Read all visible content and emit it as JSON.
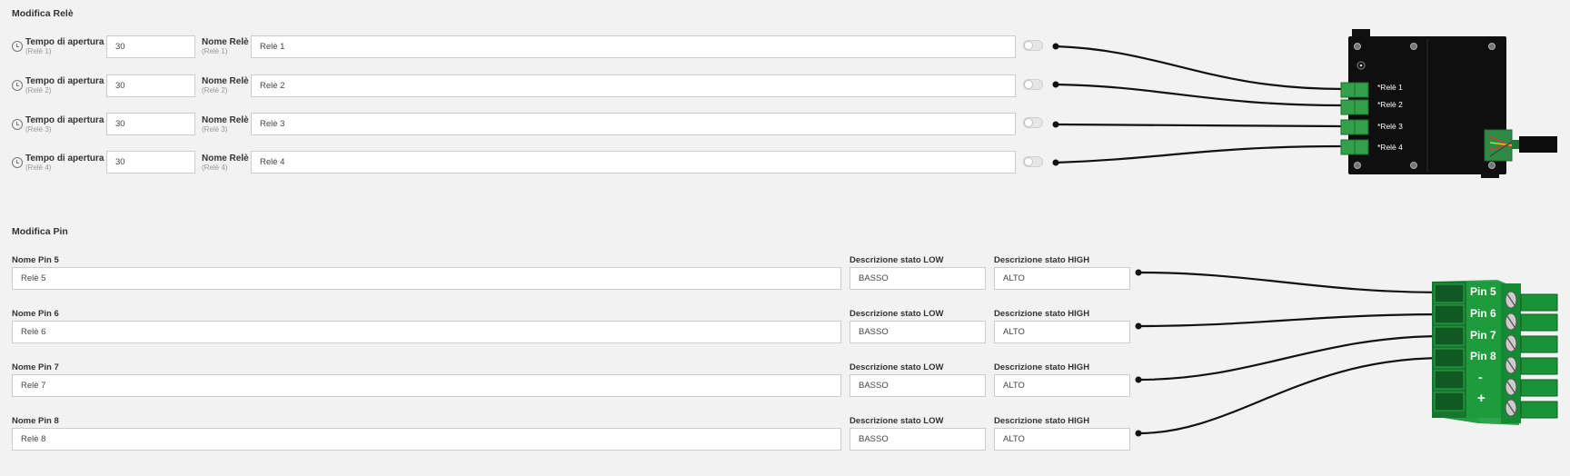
{
  "relay_section": {
    "title": "Modifica Relè",
    "rows": [
      {
        "time_label": "Tempo di apertura",
        "time_sub": "(Relè 1)",
        "time_value": "30",
        "name_label": "Nome Relè",
        "name_sub": "(Relè 1)",
        "name_value": "Relè 1",
        "toggle_on": false,
        "board_label": "*Relè 1"
      },
      {
        "time_label": "Tempo di apertura",
        "time_sub": "(Relè 2)",
        "time_value": "30",
        "name_label": "Nome Relè",
        "name_sub": "(Relè 2)",
        "name_value": "Relè 2",
        "toggle_on": false,
        "board_label": "*Relè 2"
      },
      {
        "time_label": "Tempo di apertura",
        "time_sub": "(Relè 3)",
        "time_value": "30",
        "name_label": "Nome Relè",
        "name_sub": "(Relè 3)",
        "name_value": "Relè 3",
        "toggle_on": false,
        "board_label": "*Relè 3"
      },
      {
        "time_label": "Tempo di apertura",
        "time_sub": "(Relè 4)",
        "time_value": "30",
        "name_label": "Nome Relè",
        "name_sub": "(Relè 4)",
        "name_value": "Relè 4",
        "toggle_on": false,
        "board_label": "*Relè 4"
      }
    ]
  },
  "pin_section": {
    "title": "Modifica Pin",
    "rows": [
      {
        "name_label": "Nome Pin 5",
        "name_value": "Relè 5",
        "low_label": "Descrizione stato LOW",
        "low_value": "BASSO",
        "high_label": "Descrizione stato HIGH",
        "high_value": "ALTO",
        "terminal_label": "Pin 5"
      },
      {
        "name_label": "Nome Pin 6",
        "name_value": "Relè 6",
        "low_label": "Descrizione stato LOW",
        "low_value": "BASSO",
        "high_label": "Descrizione stato HIGH",
        "high_value": "ALTO",
        "terminal_label": "Pin 6"
      },
      {
        "name_label": "Nome Pin 7",
        "name_value": "Relè 7",
        "low_label": "Descrizione stato LOW",
        "low_value": "BASSO",
        "high_label": "Descrizione stato HIGH",
        "high_value": "ALTO",
        "terminal_label": "Pin 7"
      },
      {
        "name_label": "Nome Pin 8",
        "name_value": "Relè 8",
        "low_label": "Descrizione stato LOW",
        "low_value": "BASSO",
        "high_label": "Descrizione stato HIGH",
        "high_value": "ALTO",
        "terminal_label": "Pin 8"
      }
    ],
    "terminal_minus": "-",
    "terminal_plus": "+"
  },
  "colors": {
    "background": "#f2f2f2",
    "board": "#0f0f0f",
    "connector_green": "#34a049",
    "terminal_green": "#1e9b3c",
    "wire": "#111111"
  }
}
